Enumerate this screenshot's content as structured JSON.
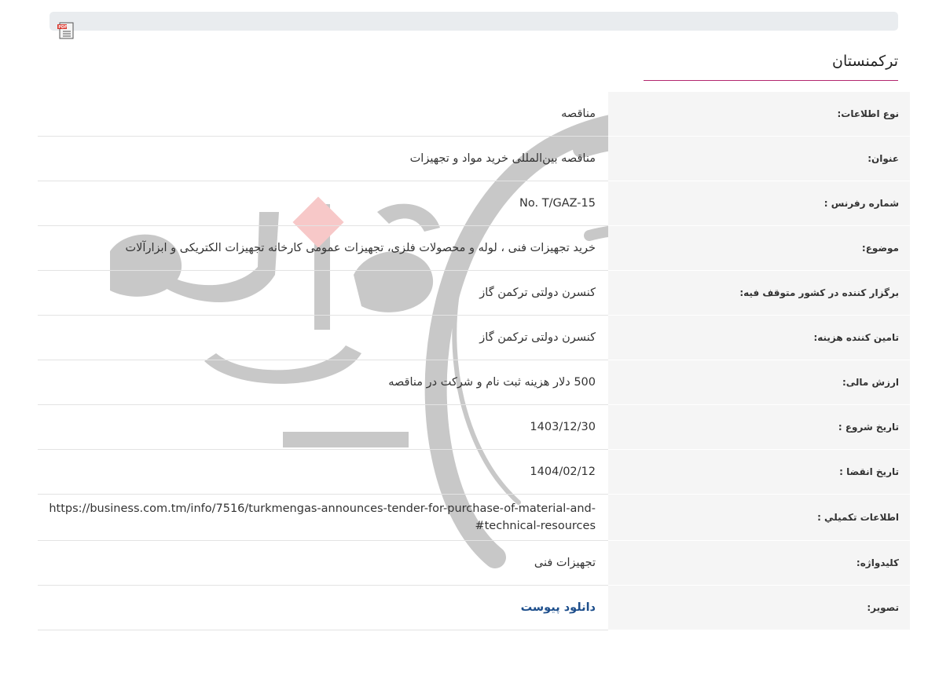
{
  "page": {
    "country_title": "ترکمنستان"
  },
  "rows": [
    {
      "label": "نوع اطلاعات:",
      "value": "مناقصه"
    },
    {
      "label": "عنوان:",
      "value": "مناقصه بین‌المللی خرید مواد و تجهیزات"
    },
    {
      "label": "شماره رفرنس :",
      "value": "No. T/GAZ-15"
    },
    {
      "label": "موضوع:",
      "value": "خرید تجهیزات فنی ، لوله و محصولات فلزی، تجهیزات عمومی کارخانه تجهیزات الکتریکی و ابزارآلات"
    },
    {
      "label": "برگزار کننده در کشور متوقف فیه:",
      "value": "کنسرن دولتی ترکمن گاز"
    },
    {
      "label": "تامین کننده هزینه:",
      "value": "کنسرن دولتی ترکمن گاز"
    },
    {
      "label": "ارزش مالی:",
      "value": "500 دلار هزینه ثبت نام و شرکت در مناقصه"
    },
    {
      "label": "تاریخ شروع :",
      "value": "1403/12/30"
    },
    {
      "label": "تاریخ انقضا :",
      "value": "1404/02/12"
    },
    {
      "label": "اطلاعات تکميلي :",
      "value_line1": "-https://business.com.tm/info/7516/turkmengas-announces-tender-for-purchase-of-material-and",
      "value_line2": "technical-resources#"
    },
    {
      "label": "کلیدواژه:",
      "value": "تجهیزات فنی"
    },
    {
      "label": "تصویر:",
      "link_text": "دانلود پیوست"
    }
  ],
  "icons": {
    "pdf": "pdf-file-icon",
    "watermark": "watermark-logo"
  },
  "colors": {
    "title_underline": "#b3286e",
    "link": "#1e4f8c",
    "label_bg": "#f5f5f5",
    "topbar_bg": "#e9ecef"
  }
}
